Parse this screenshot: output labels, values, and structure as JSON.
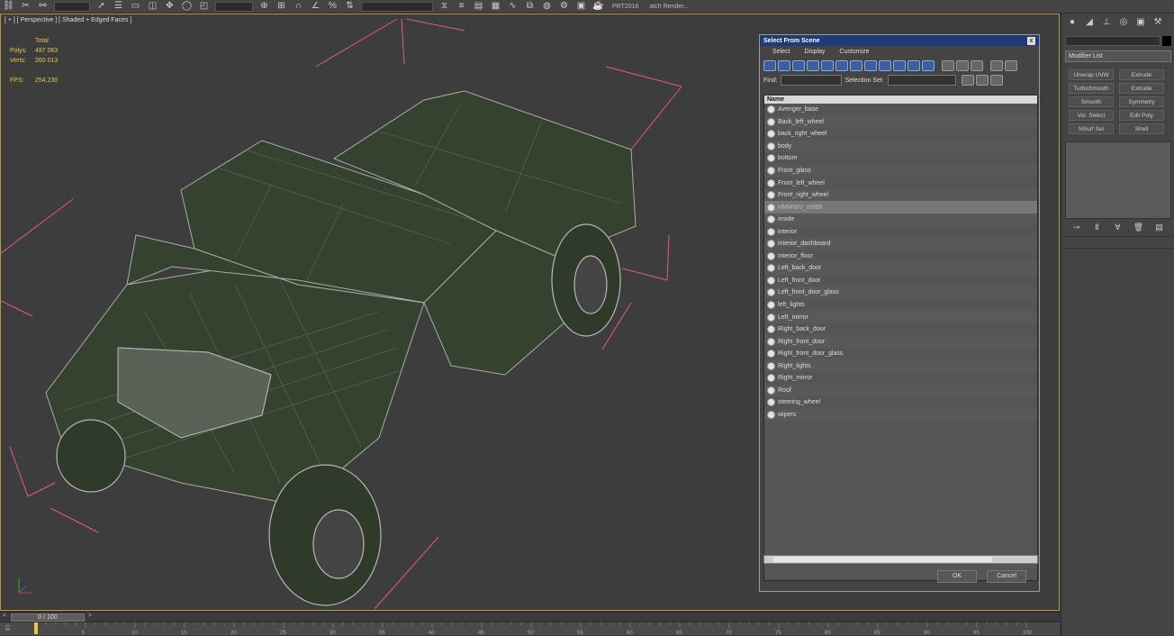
{
  "toolbar": {
    "render_text": "PRT2016",
    "batch_render": "atch Render..."
  },
  "viewport": {
    "label": "[ + ] [ Perspective ] [ Shaded + Edged Faces ]",
    "stats": {
      "total_label": "Total",
      "polys_label": "Polys:",
      "polys_value": "497 063",
      "verts_label": "Verts:",
      "verts_value": "260 013",
      "fps_label": "FPS:",
      "fps_value": "254,230"
    }
  },
  "dialog": {
    "title": "Select From Scene",
    "close": "x",
    "menu": [
      "Select",
      "Display",
      "Customize"
    ],
    "find_label": "Find:",
    "selection_set_label": "Selection Set:",
    "column_header": "Name",
    "items": [
      "Avenger_base",
      "Back_left_wheel",
      "back_right_wheel",
      "body",
      "bottom",
      "Front_glass",
      "Front_left_wheel",
      "Front_right_wheel",
      "HMMWV_m998",
      "inside",
      "interior",
      "interior_dashboard",
      "interior_floor",
      "Left_back_door",
      "Left_front_door",
      "Left_front_door_glass",
      "left_lights",
      "Left_mirror",
      "Right_back_door",
      "Right_front_door",
      "Right_front_door_glass",
      "Right_lights",
      "Right_mirror",
      "Roof",
      "steering_wheel",
      "wipers"
    ],
    "selected_item": "HMMWV_m998",
    "ok": "OK",
    "cancel": "Cancel"
  },
  "command_panel": {
    "modifier_list": "Modifier List",
    "modifiers": [
      "Unwrap UVW",
      "Extrude",
      "TurboSmooth",
      "Extrude",
      "Smooth",
      "Symmetry",
      "Vol. Select",
      "Edit Poly",
      "NSurf Sel",
      "Shell"
    ]
  },
  "timeline": {
    "slider": "0 / 100",
    "ticks": [
      "5",
      "10",
      "15",
      "20",
      "25",
      "30",
      "35",
      "40",
      "45",
      "50",
      "55",
      "60",
      "65",
      "70",
      "75",
      "80",
      "85",
      "90",
      "95",
      "100"
    ]
  },
  "colors": {
    "viewport_border": "#b39a3a",
    "stats_text": "#e8c84a",
    "dialog_title_bg": "#1f3a74",
    "model_fill": "#34422f",
    "bbox_lines": "#e05a8a"
  }
}
